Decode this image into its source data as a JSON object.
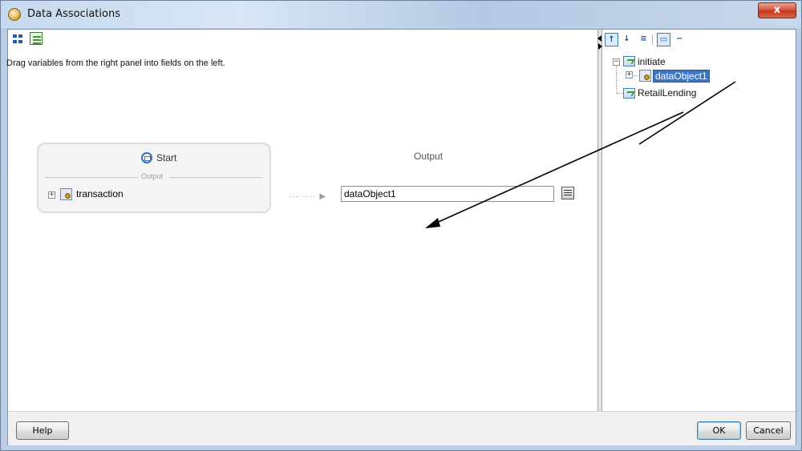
{
  "window": {
    "title": "Data Associations",
    "close_label": "x"
  },
  "toolbar_left": {
    "icons": [
      "map-variables-icon",
      "document-icon"
    ]
  },
  "instruction": "Drag variables from the right panel into fields on the left.",
  "start_box": {
    "title": "Start",
    "section_label": "Output",
    "variable": "transaction"
  },
  "output_panel": {
    "header": "Output",
    "arrow_text": "········ ▶",
    "field_value": "dataObject1"
  },
  "right_toolbar": {
    "icons": [
      "sort-ascending-icon",
      "sort-descending-icon",
      "list-view-icon",
      "view-toggle-icon",
      "collapse-icon"
    ]
  },
  "tree": {
    "root": "initiate",
    "child_selected": "dataObject1",
    "sibling": "RetailLending"
  },
  "buttons": {
    "help": "Help",
    "ok": "OK",
    "cancel": "Cancel"
  },
  "colors": {
    "selection": "#3a76c4",
    "window_chrome": "#c9d9ee",
    "close_button": "#c3371d"
  }
}
